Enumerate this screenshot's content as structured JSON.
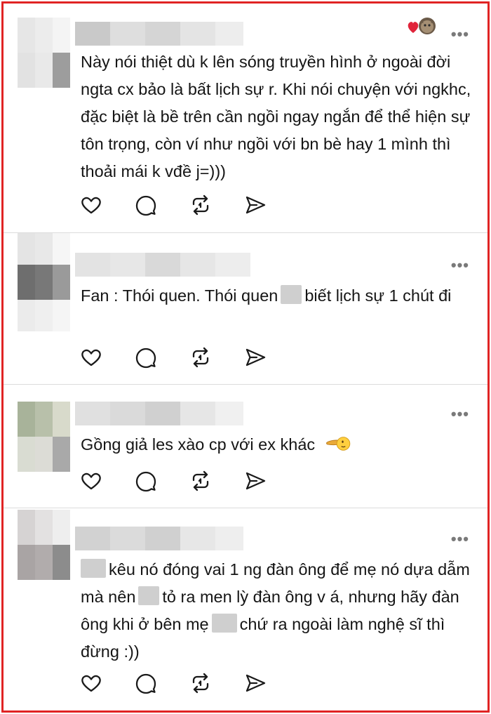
{
  "page": {
    "frame_color": "#e02424",
    "divider_color": "#dcdcdc",
    "more_icon": "more-horizontal-icon"
  },
  "comments": [
    {
      "more": "•••",
      "liked_by_author": true,
      "text": "Này nói thiệt dù k lên sóng truyền hình ở ngoài đời ngta cx bảo là bất lịch sự r. Khi nói chuyện với ngkhc, đặc biệt là bề trên cần ngồi ngay ngắn để thể hiện sự tôn trọng, còn ví như ngồi với bn bè hay 1 mình thì thoải mái k vđề j=)))",
      "actions": [
        "heart-icon",
        "comment-icon",
        "repost-icon",
        "share-icon"
      ]
    },
    {
      "more": "•••",
      "text_parts": [
        "Fan : Thói quen. Thói quen",
        "biết lịch sự 1 chút đi"
      ],
      "actions": [
        "heart-icon",
        "comment-icon",
        "repost-icon",
        "share-icon"
      ]
    },
    {
      "more": "•••",
      "text": "Gồng giả les xào cp với ex khác",
      "emoji": "pointing-hand-emoji",
      "actions": [
        "heart-icon",
        "comment-icon",
        "repost-icon",
        "share-icon"
      ]
    },
    {
      "more": "•••",
      "text_parts": [
        "kêu nó đóng vai 1 ng đàn ông để mẹ nó dựa dẫm mà nên",
        "tỏ ra men lỳ đàn ông v á, nhưng hãy đàn ông khi ở bên mẹ",
        "chứ ra ngoài làm nghệ sĩ thì đừng :))"
      ],
      "actions": [
        "heart-icon",
        "comment-icon",
        "repost-icon",
        "share-icon"
      ]
    }
  ]
}
